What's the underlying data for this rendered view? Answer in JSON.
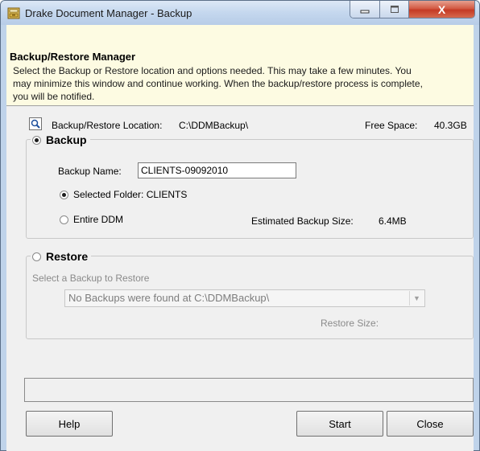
{
  "window": {
    "title": "Drake Document Manager - Backup",
    "close_glyph": "X",
    "accent_color": "#bfd3ea"
  },
  "header": {
    "title": "Backup/Restore Manager",
    "description": "Select the Backup or Restore location and options needed. This may take a few minutes. You may minimize this window and continue working. When the backup/restore process is complete, you will be notified."
  },
  "location": {
    "label": "Backup/Restore Location:",
    "path": "C:\\DDMBackup\\",
    "free_space_label": "Free Space:",
    "free_space_value": "40.3GB",
    "icon": "browse-folder-icon"
  },
  "backup": {
    "title": "Backup",
    "selected": true,
    "name_label": "Backup Name:",
    "name_value": "CLIENTS-09092010",
    "option_selected_folder": "Selected Folder: CLIENTS",
    "option_entire_ddm": "Entire DDM",
    "selected_option": "selected_folder",
    "estimated_size_label": "Estimated Backup Size:",
    "estimated_size_value": "6.4MB"
  },
  "restore": {
    "title": "Restore",
    "selected": false,
    "select_label": "Select a Backup to Restore",
    "combo_value": "No Backups were found at C:\\DDMBackup\\",
    "size_label": "Restore Size:"
  },
  "buttons": {
    "help": "Help",
    "start": "Start",
    "close": "Close"
  }
}
